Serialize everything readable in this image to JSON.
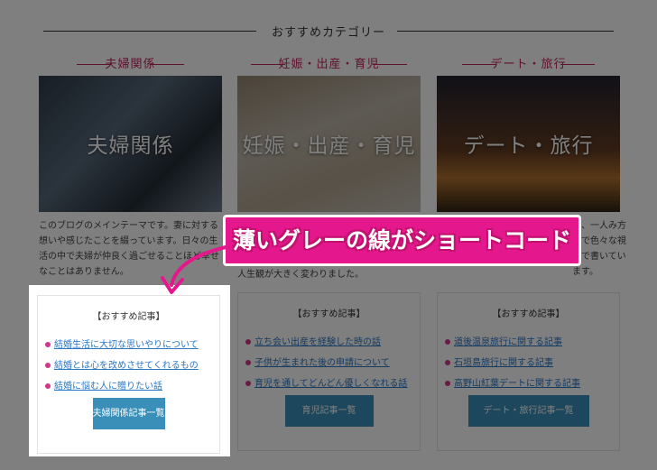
{
  "section": {
    "title": "おすすめカテゴリー"
  },
  "categories": [
    {
      "name": "夫婦関係",
      "image_text": "夫婦関係",
      "desc": "このブログのメインテーマです。妻に対する想いや感じたことを綴っています。日々の生活の中で夫婦が仲良く過ごせることほど幸せなことはありません。",
      "box_title": "【おすすめ記事】",
      "links": [
        "結婚生活に大切な思いやりについて",
        "結婚とは心を改めさせてくれるもの",
        "結婚に悩む人に贈りたい話"
      ],
      "button": "夫婦関係記事一覧"
    },
    {
      "name": "妊娠・出産・育児",
      "image_text": "妊娠・出産・育児",
      "desc": "人生観が大きく変わりました。",
      "box_title": "【おすすめ記事】",
      "links": [
        "立ち会い出産を経験した時の話",
        "子供が生まれた後の申請について",
        "育児を通してどんどん優しくなれる話"
      ],
      "button": "育児記事一覧"
    },
    {
      "name": "デート・旅行",
      "image_text": "デート・旅行",
      "desc": "所、一人み方まで色々な視点で書いています。",
      "box_title": "【おすすめ記事】",
      "links": [
        "道後温泉旅行に関する記事",
        "石垣島旅行に関する記事",
        "高野山紅葉デートに関する記事"
      ],
      "button": "デート・旅行記事一覧"
    }
  ],
  "callout": {
    "text": "薄いグレーの線がショートコード"
  },
  "colors": {
    "accent": "#c0245f",
    "button": "#3a8fb8",
    "callout": "#e5178c",
    "link": "#2a77c4",
    "bullet": "#d0378a"
  }
}
